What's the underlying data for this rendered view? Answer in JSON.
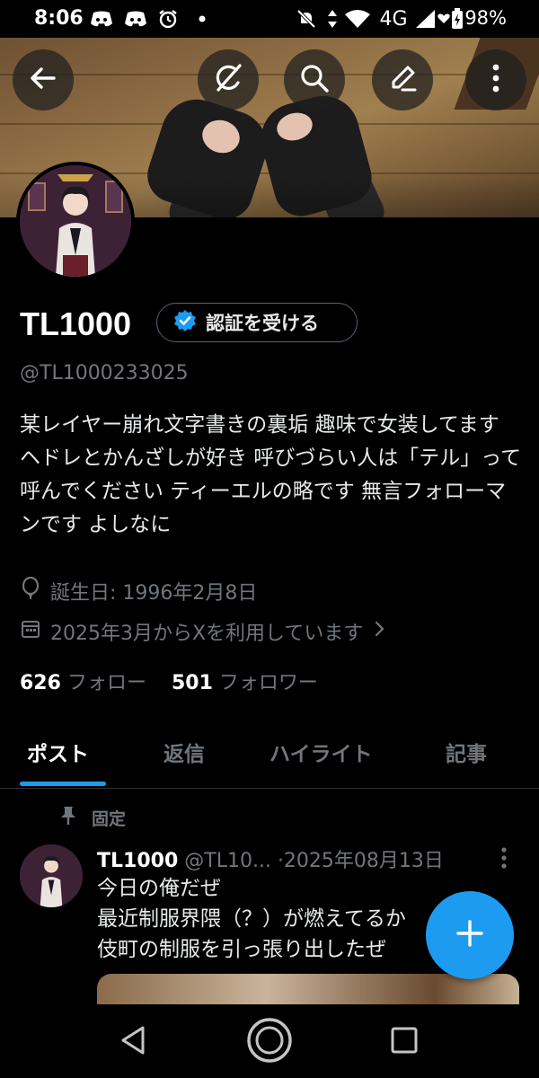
{
  "status_bar": {
    "time": "8:06",
    "network": "4G",
    "battery": "98%",
    "left_icons": [
      "discord-icon",
      "discord-icon",
      "alarm-icon",
      "dot-icon"
    ],
    "right_icons": [
      "mute-icon",
      "data-arrows-icon",
      "wifi-icon",
      "signal-icon",
      "battery-icon"
    ]
  },
  "header": {
    "back_icon": "back-arrow-icon",
    "grok_icon": "grok-icon",
    "search_icon": "search-icon",
    "edit_icon": "edit-icon",
    "more_icon": "more-vertical-icon"
  },
  "profile": {
    "name": "TL1000",
    "verify_label": "認証を受ける",
    "handle": "@TL1000233025",
    "bio": "某レイヤー崩れ文字書きの裏垢 趣味で女装してます ヘドレとかんざしが好き 呼びづらい人は「テル」って呼んでください ティーエルの略です 無言フォローマンです よしなに",
    "birthday": "誕生日: 1996年2月8日",
    "joined": "2025年3月からXを利用しています",
    "following_count": "626",
    "following_label": "フォロー",
    "followers_count": "501",
    "followers_label": "フォロワー"
  },
  "tabs": [
    {
      "label": "ポスト",
      "active": true
    },
    {
      "label": "返信",
      "active": false
    },
    {
      "label": "ハイライト",
      "active": false
    },
    {
      "label": "記事",
      "active": false
    }
  ],
  "post": {
    "pinned_label": "固定",
    "name": "TL1000",
    "handle": "@TL10...",
    "date": "·2025年08月13日",
    "lines": [
      "今日の俺だぜ",
      "最近制服界隈（？）が燃えてるか",
      "伎町の制服を引っ張り出したぜ"
    ]
  },
  "colors": {
    "accent": "#1d9bf0",
    "background": "#000000",
    "secondary_text": "#71767b"
  }
}
